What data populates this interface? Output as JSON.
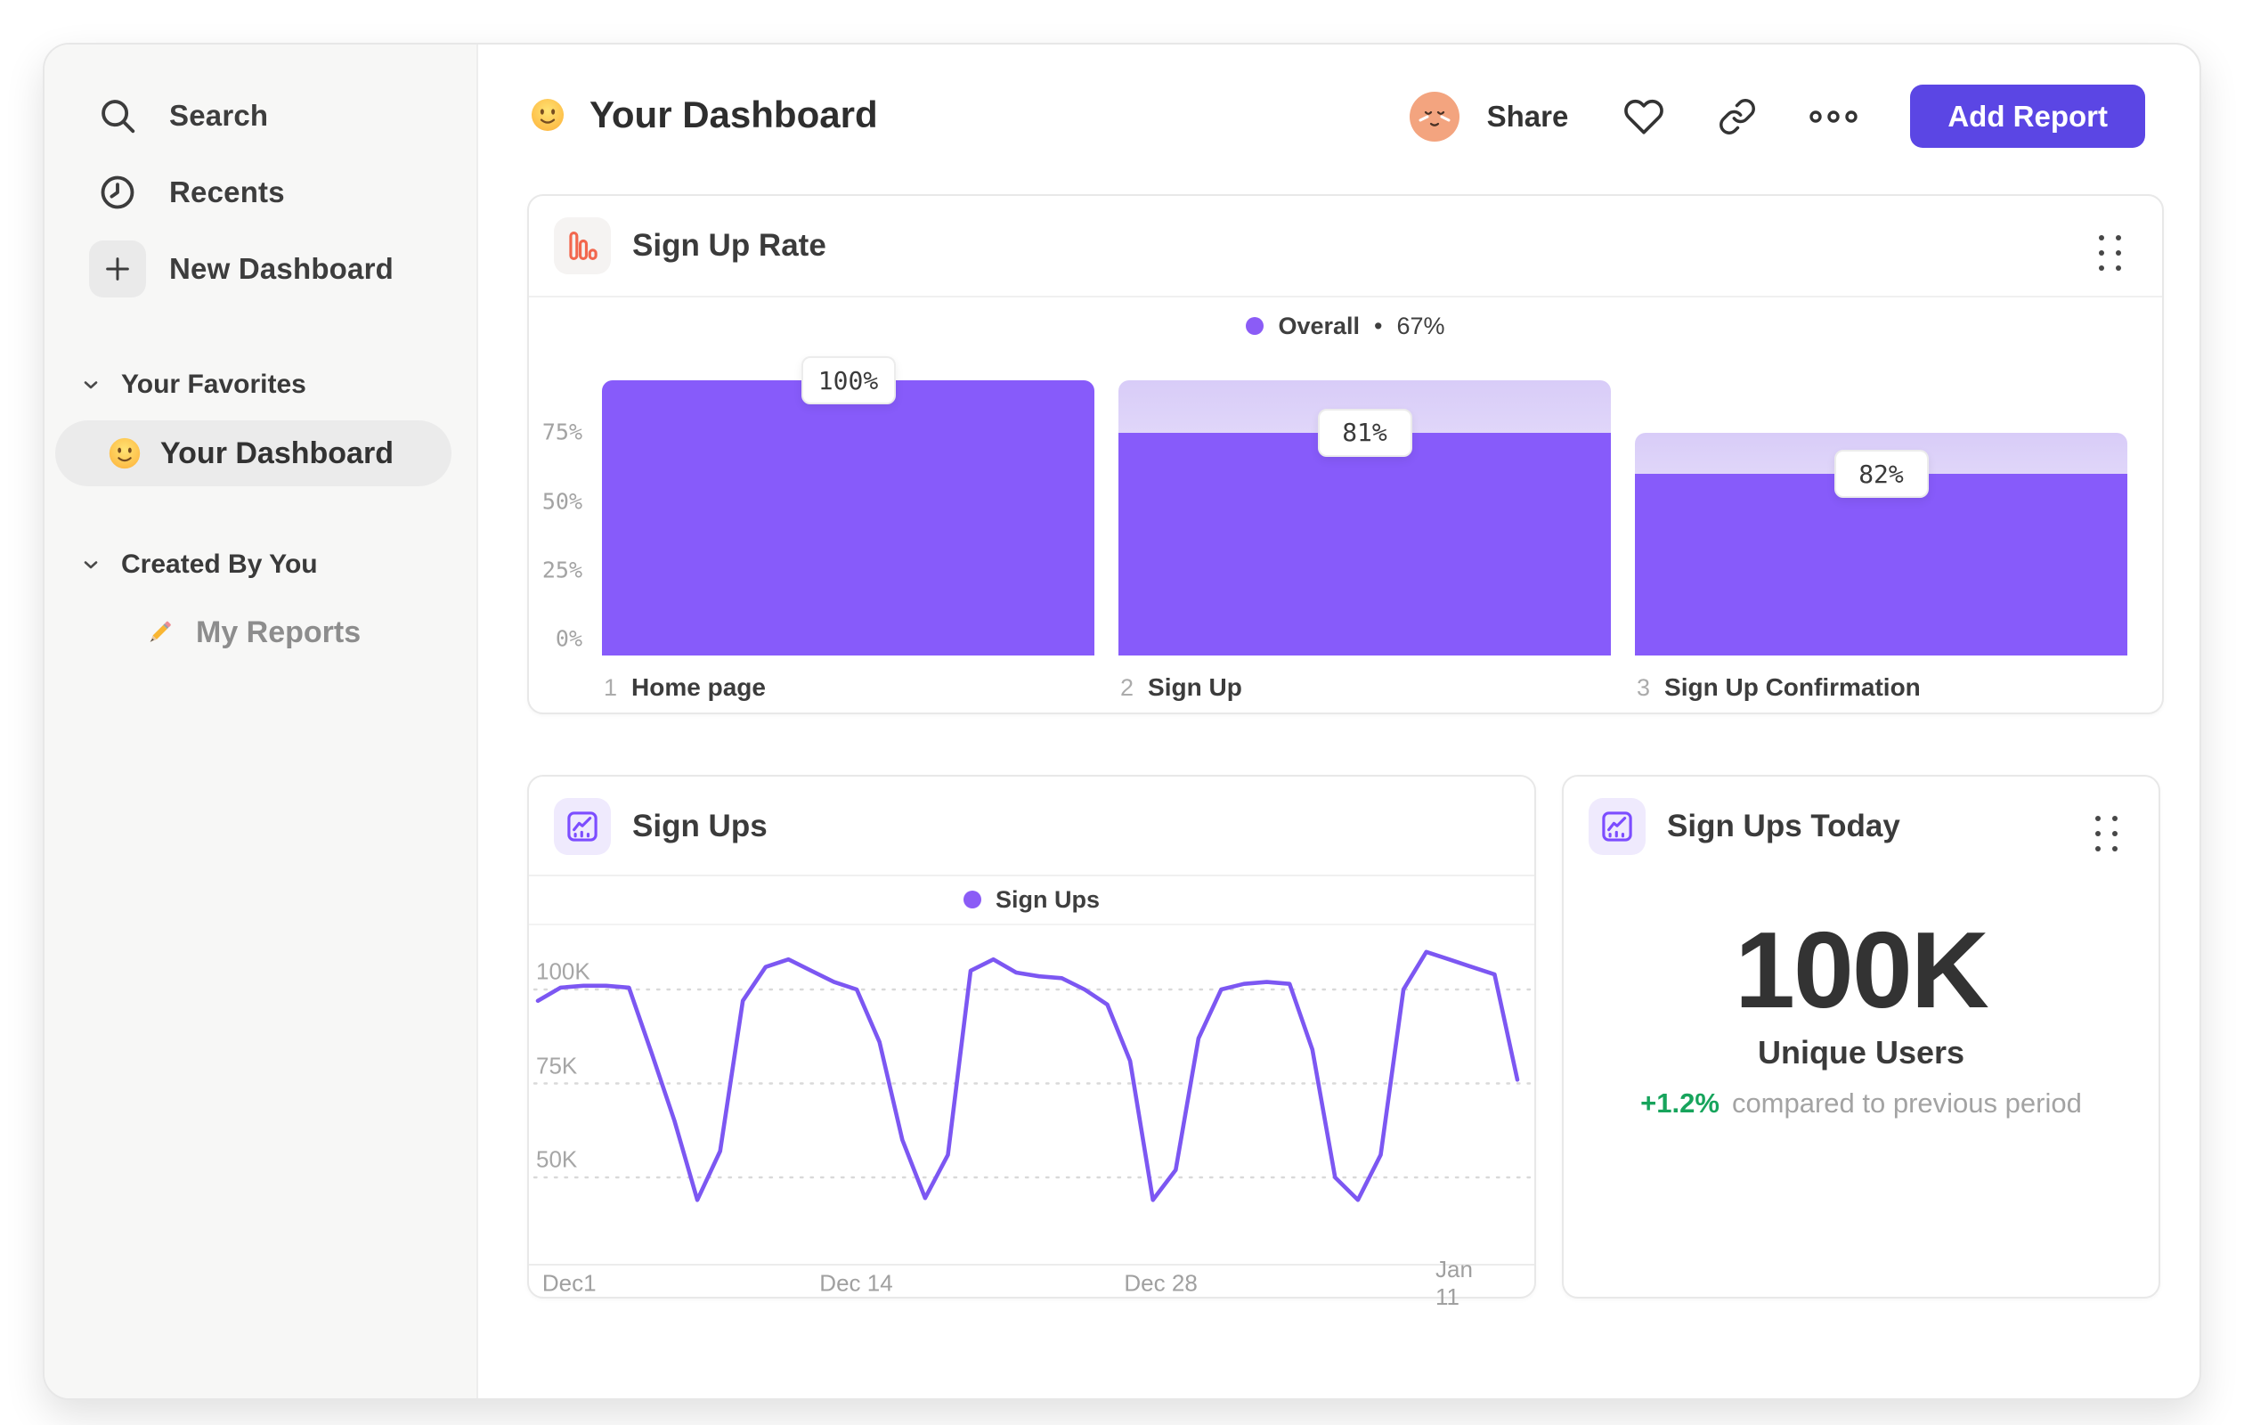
{
  "colors": {
    "accent_purple": "#875BFA",
    "line_purple": "#7C57F2",
    "legend_dot": "#8B5CF6",
    "button_indigo": "#5B46E4",
    "funnel_icon_orange": "#F2674E",
    "chart_icon_purple": "#7C4DFF",
    "delta_green": "#17A45C"
  },
  "sidebar": {
    "items": [
      {
        "icon": "search-icon",
        "label": "Search"
      },
      {
        "icon": "clock-icon",
        "label": "Recents"
      },
      {
        "icon": "plus-icon",
        "label": "New Dashboard"
      }
    ],
    "sections": [
      {
        "title": "Your Favorites",
        "items": [
          {
            "emoji": "🙂",
            "icon": "smiley-emoji",
            "label": "Your Dashboard",
            "active": true
          }
        ]
      },
      {
        "title": "Created By You",
        "items": [
          {
            "emoji": "✏️",
            "icon": "pencil-emoji",
            "label": "My Reports",
            "active": false
          }
        ]
      }
    ]
  },
  "header": {
    "emoji": "🙂",
    "title": "Your Dashboard",
    "share_label": "Share",
    "add_report_label": "Add Report"
  },
  "funnel_card": {
    "title": "Sign Up Rate",
    "legend_label": "Overall",
    "legend_separator": "•",
    "legend_value": "67%"
  },
  "line_card": {
    "title": "Sign Ups",
    "legend_label": "Sign Ups"
  },
  "metric_card": {
    "title": "Sign Ups Today",
    "value": "100K",
    "label": "Unique Users",
    "delta": "+1.2%",
    "delta_note": "compared to previous period"
  },
  "chart_data": [
    {
      "type": "bar",
      "subtype": "funnel",
      "title": "Sign Up Rate",
      "legend": "Overall • 67%",
      "ylabel": "",
      "ylim": [
        0,
        100
      ],
      "y_ticks": [
        "75%",
        "50%",
        "25%",
        "0%"
      ],
      "steps": [
        {
          "index": "1",
          "label": "Home page",
          "conversion_label": "100%",
          "conversion_pct": 100,
          "absolute_pct": 100,
          "prev_absolute_pct": 100
        },
        {
          "index": "2",
          "label": "Sign Up",
          "conversion_label": "81%",
          "conversion_pct": 81,
          "absolute_pct": 81,
          "prev_absolute_pct": 100
        },
        {
          "index": "3",
          "label": "Sign Up Confirmation",
          "conversion_label": "82%",
          "conversion_pct": 82,
          "absolute_pct": 66,
          "prev_absolute_pct": 81
        }
      ],
      "overall_conversion": "67%"
    },
    {
      "type": "line",
      "title": "Sign Ups",
      "legend": "Sign Ups",
      "grid": "dashed-horizontal",
      "x_tick_labels": [
        "Dec1",
        "Dec 14",
        "Dec 28",
        "Jan 11"
      ],
      "x_tick_fractions": [
        0.032,
        0.325,
        0.636,
        0.95
      ],
      "y_ticks": [
        {
          "label": "100K",
          "value": 100
        },
        {
          "label": "75K",
          "value": 75
        },
        {
          "label": "50K",
          "value": 50
        }
      ],
      "unit": "K",
      "ylim_k": [
        27,
        115
      ],
      "values_k": [
        97,
        100.5,
        101,
        101,
        100.5,
        83,
        65,
        44,
        57,
        97,
        106,
        108,
        105,
        102,
        100,
        86,
        60,
        44.5,
        56,
        105,
        108,
        104.5,
        103.5,
        103,
        100,
        96,
        81,
        44,
        52,
        87,
        100,
        101.5,
        102,
        101.5,
        84,
        50,
        44,
        56,
        100,
        110,
        108,
        106,
        104,
        76
      ]
    }
  ]
}
